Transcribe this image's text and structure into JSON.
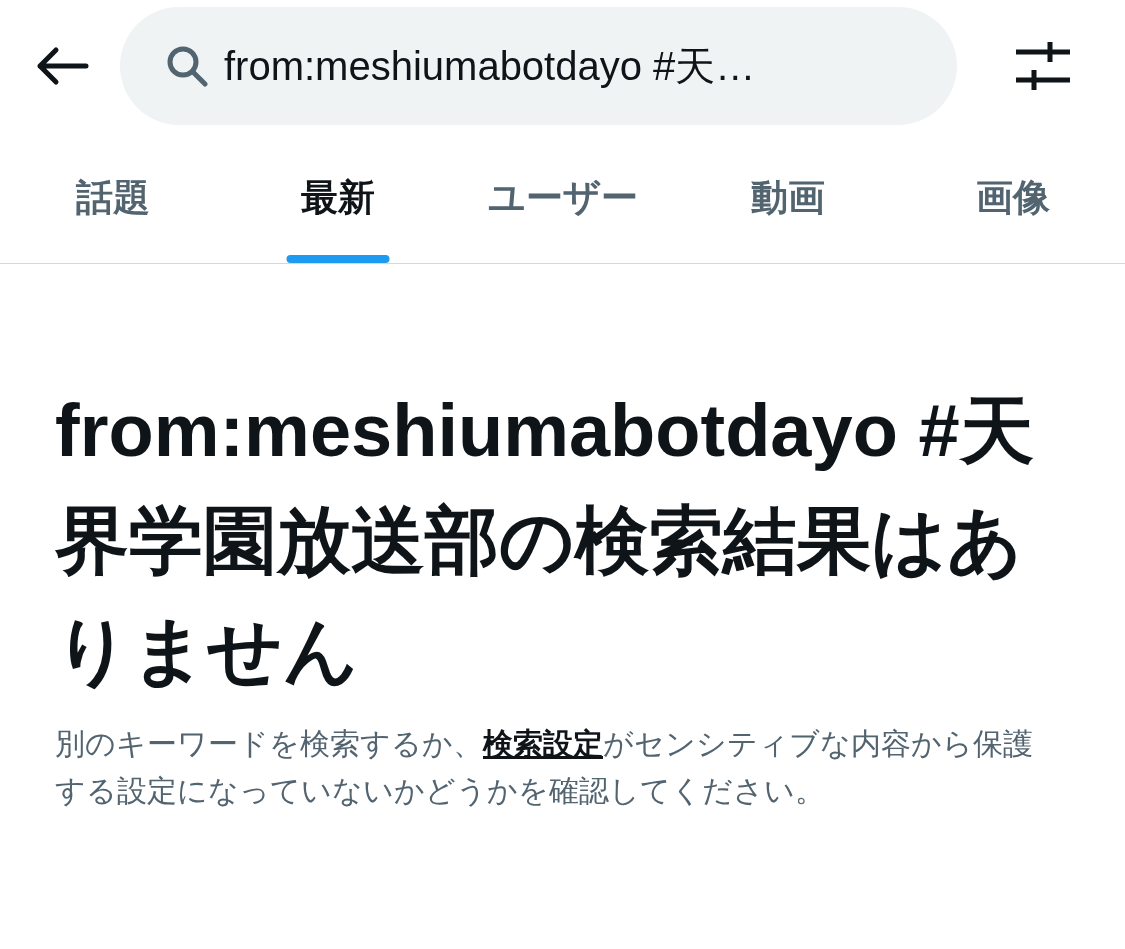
{
  "search": {
    "value": "from:meshiumabotdayo #天…"
  },
  "tabs": [
    {
      "label": "話題",
      "selected": false
    },
    {
      "label": "最新",
      "selected": true
    },
    {
      "label": "ユーザー",
      "selected": false
    },
    {
      "label": "動画",
      "selected": false
    },
    {
      "label": "画像",
      "selected": false
    }
  ],
  "empty_state": {
    "title": "from:meshiumabotdayo #天界学園放送部の検索結果はありません",
    "description_before": "別のキーワードを検索するか、",
    "description_link": "検索設定",
    "description_after": "がセンシティブな内容から保護する設定になっていないかどうかを確認してください。"
  }
}
